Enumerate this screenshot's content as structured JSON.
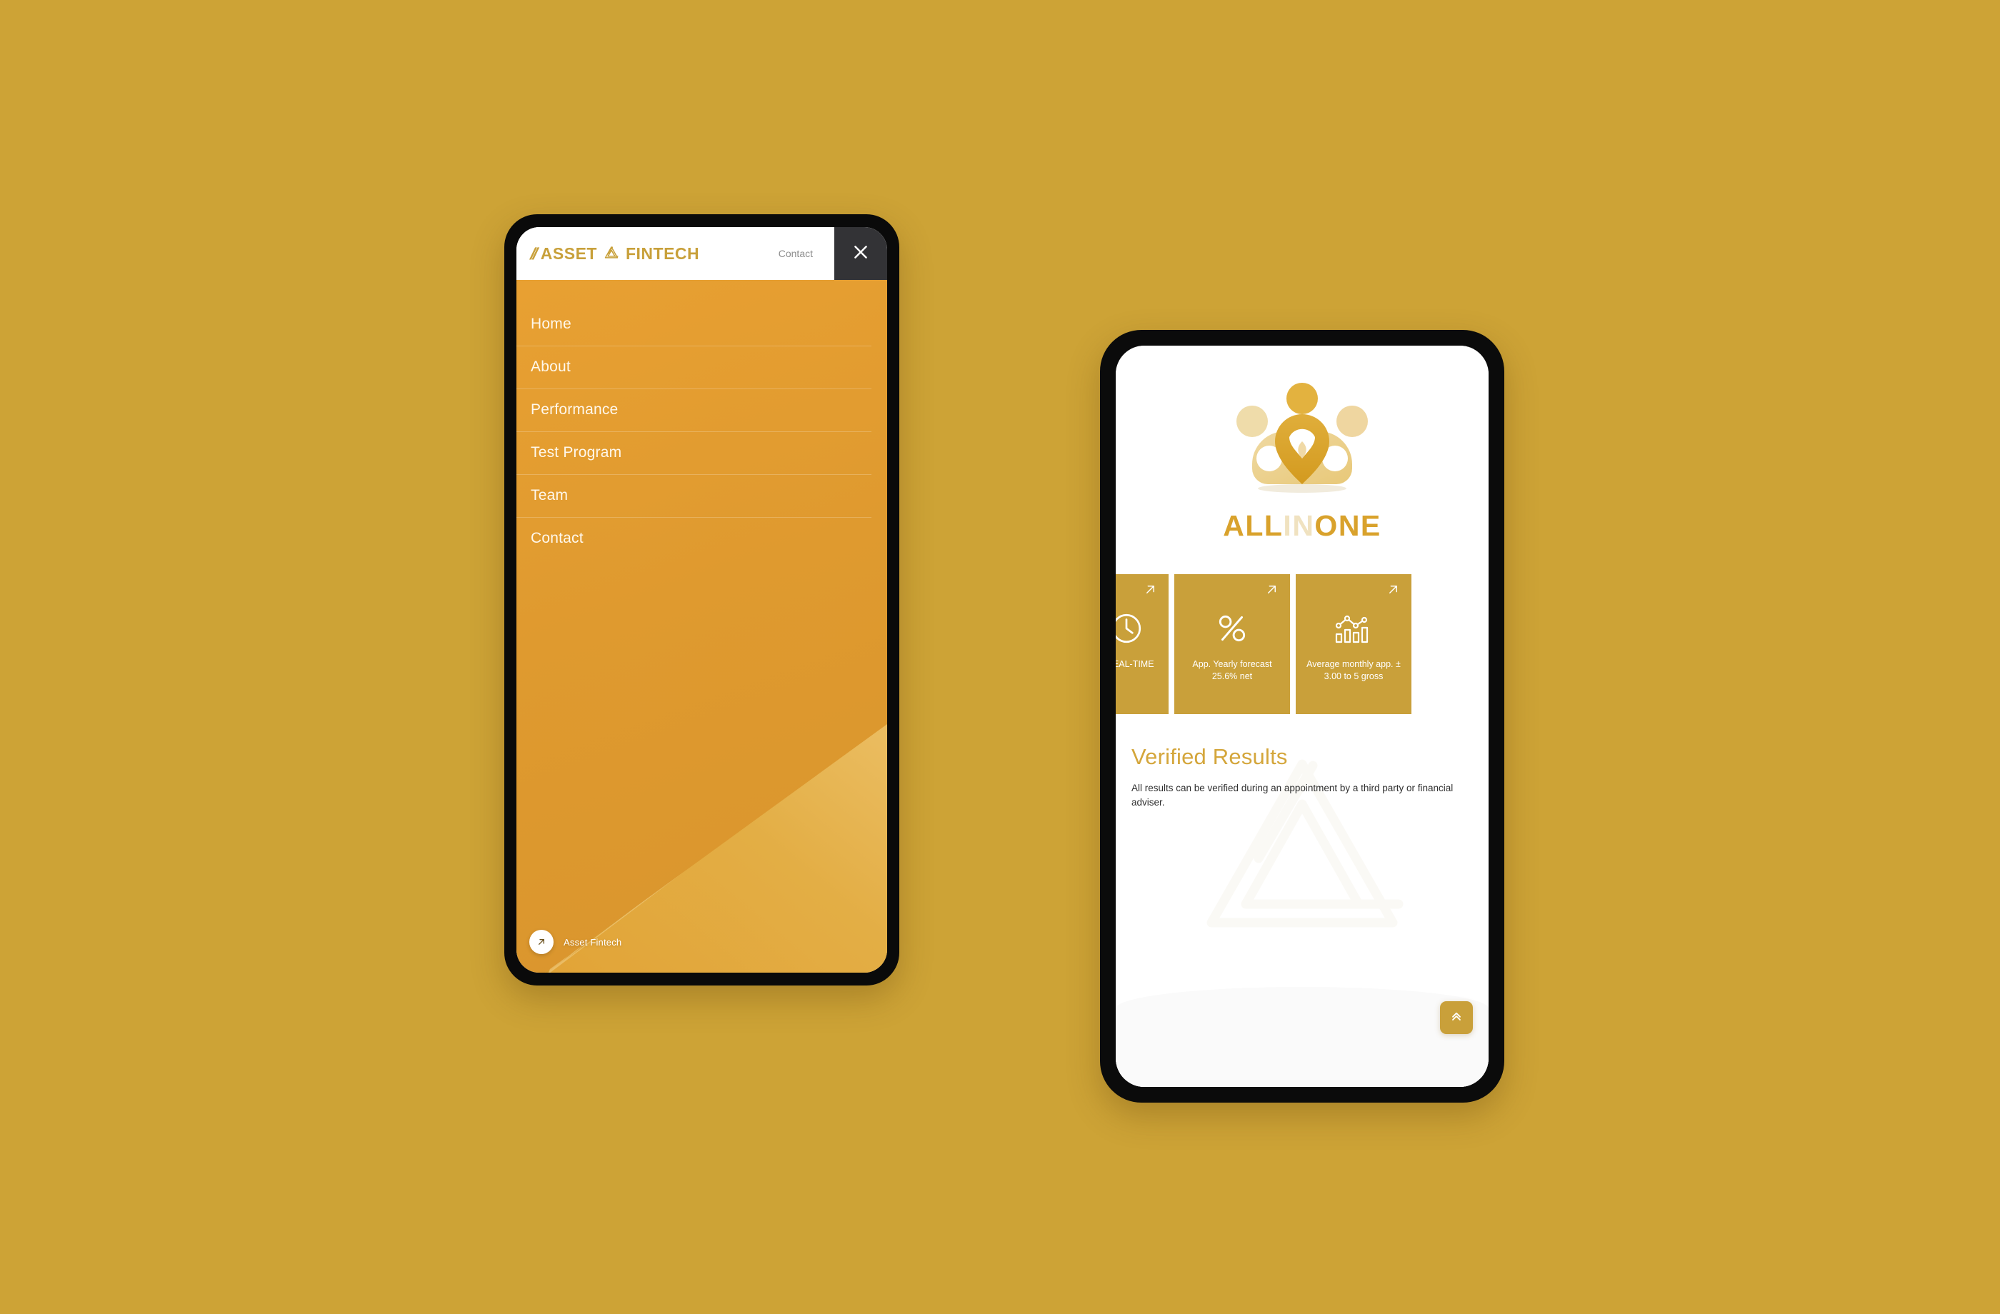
{
  "canvas": {
    "background_color": "#CDA336"
  },
  "left_phone": {
    "name": "asset-fintech-mobile-menu",
    "header": {
      "logo_prefix": "//",
      "logo_first": "ASSET",
      "logo_second": "FINTECH",
      "logo_mark": "trefoil-knot-icon",
      "contact_link": "Contact",
      "close_icon": "close-icon",
      "logo_color": "#C8A03A",
      "close_bg_color": "#333336"
    },
    "menu": {
      "items": [
        {
          "label": "Home"
        },
        {
          "label": "About"
        },
        {
          "label": "Performance"
        },
        {
          "label": "Test Program"
        },
        {
          "label": "Team"
        },
        {
          "label": "Contact"
        }
      ],
      "panel_color": "#E09A2F"
    },
    "credit": {
      "icon": "arrow-up-right-icon",
      "label": "Asset Fintech"
    }
  },
  "right_phone": {
    "name": "allinone-mobile-page",
    "hero": {
      "logo_mark": "people-group-pin-icon",
      "word_part_1": "ALL",
      "word_part_2": "IN",
      "word_part_3": "ONE",
      "color_gold": "#D9A22C",
      "color_pale": "#F0E2C0"
    },
    "cards": [
      {
        "icon": "clock-icon",
        "text": "n REAL-TIME",
        "arrow": "arrow-up-right-icon"
      },
      {
        "icon": "percent-icon",
        "text": "App. Yearly forecast 25.6% net",
        "arrow": "arrow-up-right-icon"
      },
      {
        "icon": "bar-chart-trend-icon",
        "text": "Average monthly app. ± 3.00 to 5 gross",
        "arrow": "arrow-up-right-icon"
      }
    ],
    "cards_color": "#C9A03A",
    "verified": {
      "title": "Verified Results",
      "body": "All results can be verified during an appointment by a third party or financial adviser.",
      "title_color": "#D4A63B",
      "watermark_icon": "trefoil-knot-watermark-icon"
    },
    "scroll_top_button": {
      "icon": "double-chevron-up-icon",
      "color": "#C9A03A"
    }
  }
}
